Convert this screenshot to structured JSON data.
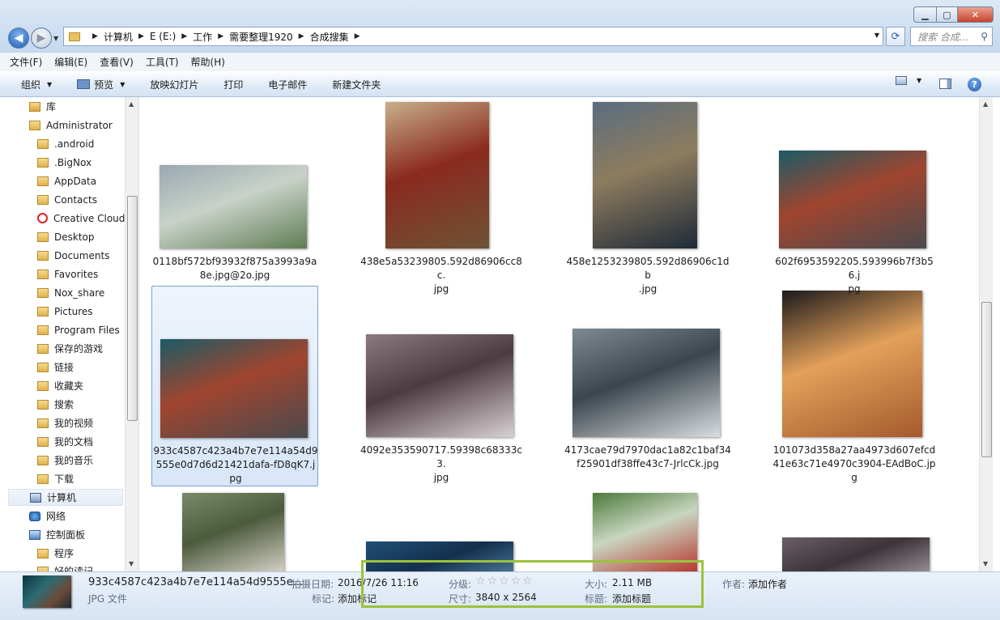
{
  "address": {
    "crumbs": [
      "计算机",
      "E (E:)",
      "工作",
      "需要整理1920",
      "合成搜集"
    ]
  },
  "search": {
    "placeholder": "搜索 合成..."
  },
  "menu": [
    "文件(F)",
    "编辑(E)",
    "查看(V)",
    "工具(T)",
    "帮助(H)"
  ],
  "toolbar": {
    "organize": "组织",
    "preview": "预览",
    "slideshow": "放映幻灯片",
    "print": "打印",
    "email": "电子邮件",
    "new_folder": "新建文件夹"
  },
  "nav": [
    {
      "label": "库",
      "icon": "library-icon"
    },
    {
      "label": "Administrator",
      "icon": "user-folder-icon"
    },
    {
      "label": ".android",
      "icon": "folder-icon"
    },
    {
      "label": ".BigNox",
      "icon": "folder-icon"
    },
    {
      "label": "AppData",
      "icon": "folder-icon"
    },
    {
      "label": "Contacts",
      "icon": "folder-icon"
    },
    {
      "label": "Creative Cloud",
      "icon": "creative-cloud-icon"
    },
    {
      "label": "Desktop",
      "icon": "folder-icon"
    },
    {
      "label": "Documents",
      "icon": "folder-icon"
    },
    {
      "label": "Favorites",
      "icon": "folder-icon"
    },
    {
      "label": "Nox_share",
      "icon": "folder-icon"
    },
    {
      "label": "Pictures",
      "icon": "folder-icon"
    },
    {
      "label": "Program Files",
      "icon": "folder-icon"
    },
    {
      "label": "保存的游戏",
      "icon": "folder-icon"
    },
    {
      "label": "链接",
      "icon": "folder-icon"
    },
    {
      "label": "收藏夹",
      "icon": "folder-icon"
    },
    {
      "label": "搜索",
      "icon": "folder-icon"
    },
    {
      "label": "我的视频",
      "icon": "folder-icon"
    },
    {
      "label": "我的文档",
      "icon": "folder-icon"
    },
    {
      "label": "我的音乐",
      "icon": "folder-icon"
    },
    {
      "label": "下载",
      "icon": "folder-icon"
    },
    {
      "label": "计算机",
      "icon": "computer-icon"
    },
    {
      "label": "网络",
      "icon": "network-icon"
    },
    {
      "label": "控制面板",
      "icon": "control-panel-icon"
    },
    {
      "label": "程序",
      "icon": "folder-icon"
    },
    {
      "label": "好的读记",
      "icon": "folder-icon"
    }
  ],
  "files": [
    {
      "lines": [
        "0118bf572bf93932f875a3993a9a",
        "8e.jpg@2o.jpg"
      ],
      "colors": [
        "#9aa8b0",
        "#5e7d52",
        "#c9d2c9"
      ]
    },
    {
      "lines": [
        "438e5a53239805.592d86906cc8c.",
        "jpg"
      ],
      "colors": [
        "#c7b08a",
        "#6d5336",
        "#8b2a1f"
      ]
    },
    {
      "lines": [
        "458e1253239805.592d86906c1db",
        ".jpg"
      ],
      "colors": [
        "#5a6d80",
        "#1f2a38",
        "#8d7c5e"
      ]
    },
    {
      "lines": [
        "602f6953592205.593996b7f3b56.j",
        "pg"
      ],
      "colors": [
        "#1b5b66",
        "#4a4a4e",
        "#a0452f"
      ]
    },
    {
      "lines": [
        "933c4587c423a4b7e7e114a54d9",
        "555e0d7d6d21421dafa-fD8qK7.j",
        "pg"
      ],
      "colors": [
        "#1b5b66",
        "#4a4a4e",
        "#a0452f"
      ]
    },
    {
      "lines": [
        "4092e353590717.59398c68333c3.",
        "jpg"
      ],
      "colors": [
        "#8c7a82",
        "#d8d0d4",
        "#4d3b42"
      ]
    },
    {
      "lines": [
        "4173cae79d7970dac1a82c1baf34",
        "f25901df38ffe43c7-JrlcCk.jpg"
      ],
      "colors": [
        "#7e8a91",
        "#d7dde0",
        "#3c464d"
      ]
    },
    {
      "lines": [
        "101073d358a27aa4973d607efcd",
        "41e63c71e4970c3904-EAdBoC.jp",
        "g"
      ],
      "colors": [
        "#1c1a1c",
        "#a45a2c",
        "#e3a05a"
      ]
    },
    {
      "lines": [],
      "colors": [
        "#7a8a6a",
        "#d8d4c9",
        "#4d5b3d"
      ]
    },
    {
      "lines": [],
      "colors": [
        "#1e4f78",
        "#5f93b8",
        "#15304c"
      ]
    },
    {
      "lines": [],
      "colors": [
        "#4c7a3a",
        "#b7322a",
        "#c8d6c0"
      ]
    },
    {
      "lines": [],
      "colors": [
        "#6a5f66",
        "#b3a9ae",
        "#3c3439"
      ]
    }
  ],
  "details": {
    "filename": "933c4587c423a4b7e7e114a54d9555e...",
    "filetype": "JPG 文件",
    "date_label": "拍摄日期:",
    "date_value": "2016/7/26 11:16",
    "tags_label": "标记:",
    "tags_value": "添加标记",
    "rating_label": "分级:",
    "rating": 0,
    "dimensions_label": "尺寸:",
    "dimensions_value": "3840 x 2564",
    "size_label": "大小:",
    "size_value": "2.11 MB",
    "title_label": "标题:",
    "title_value": "添加标题",
    "author_label": "作者:",
    "author_value": "添加作者"
  },
  "colors": {
    "highlight": "#9bc23a",
    "selection": "#d8e6f8"
  }
}
